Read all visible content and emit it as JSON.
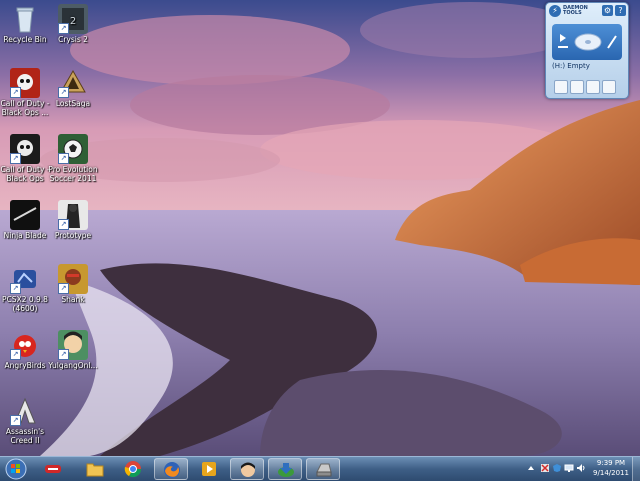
{
  "desktop": {
    "icons": [
      {
        "label": "Recycle Bin",
        "name": "recycle-bin"
      },
      {
        "label": "Crysis 2",
        "name": "crysis-2"
      },
      {
        "label": "Call of Duty -\nBlack Ops ...",
        "name": "call-of-duty-black-ops-mp"
      },
      {
        "label": "LostSaga",
        "name": "lostsaga"
      },
      {
        "label": "Call of Duty -\nBlack Ops",
        "name": "call-of-duty-black-ops"
      },
      {
        "label": "Pro Evolution\nSoccer 2011",
        "name": "pro-evolution-soccer"
      },
      {
        "label": "Ninja Blade",
        "name": "ninja-blade"
      },
      {
        "label": "Prototype",
        "name": "prototype"
      },
      {
        "label": "PCSX2 0.9.8\n(4600)",
        "name": "pcsx2"
      },
      {
        "label": "Shank",
        "name": "shank"
      },
      {
        "label": "AngryBirds",
        "name": "angry-birds"
      },
      {
        "label": "YulgangOnl...",
        "name": "yulgang-online"
      },
      {
        "label": "Assassin's\nCreed II",
        "name": "assassins-creed-2"
      }
    ]
  },
  "daemon_gadget": {
    "title": "DAEMON TOOLS",
    "drive_label": "(H:) Empty"
  },
  "taskbar": {
    "items": [
      {
        "name": "taskbar-item-smadav",
        "icon": "smadav-icon"
      },
      {
        "name": "taskbar-item-explorer",
        "icon": "folder-icon"
      },
      {
        "name": "taskbar-item-chrome",
        "icon": "chrome-icon"
      },
      {
        "name": "taskbar-item-firefox",
        "icon": "firefox-icon"
      },
      {
        "name": "taskbar-item-media",
        "icon": "media-player-icon"
      },
      {
        "name": "taskbar-item-game",
        "icon": "game-avatar-icon"
      },
      {
        "name": "taskbar-item-idm",
        "icon": "download-manager-icon"
      },
      {
        "name": "taskbar-item-drive",
        "icon": "drive-icon"
      }
    ],
    "clock": {
      "time": "9:39 PM",
      "date": "9/14/2011"
    }
  }
}
